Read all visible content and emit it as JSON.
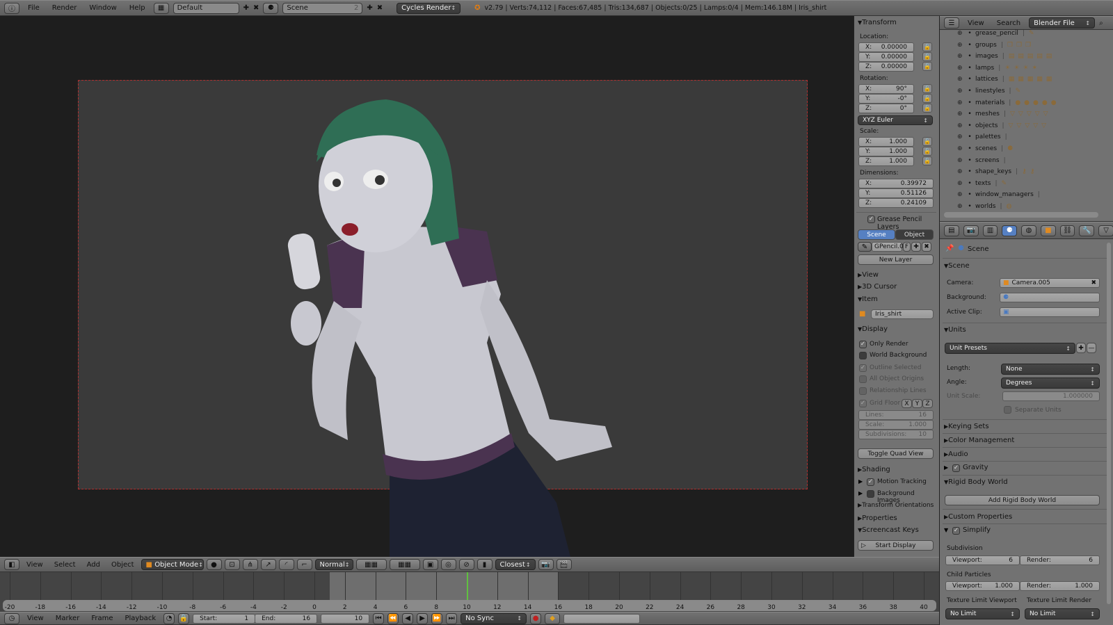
{
  "topbar": {
    "menus": [
      "File",
      "Render",
      "Window",
      "Help"
    ],
    "layout": "Default",
    "scene": "Scene",
    "scene_users": "2",
    "engine": "Cycles Render",
    "stats": "v2.79 | Verts:74,112 | Faces:67,485 | Tris:134,687 | Objects:0/25 | Lamps:0/4 | Mem:146.18M | Iris_shirt"
  },
  "npanel": {
    "transform": "Transform",
    "location": "Location:",
    "rotation": "Rotation:",
    "scale": "Scale:",
    "dimensions": "Dimensions:",
    "rotation_mode": "XYZ Euler",
    "loc": [
      {
        "a": "X:",
        "v": "0.00000"
      },
      {
        "a": "Y:",
        "v": "0.00000"
      },
      {
        "a": "Z:",
        "v": "0.00000"
      }
    ],
    "rot": [
      {
        "a": "X:",
        "v": "90°"
      },
      {
        "a": "Y:",
        "v": "-0°"
      },
      {
        "a": "Z:",
        "v": "0°"
      }
    ],
    "scl": [
      {
        "a": "X:",
        "v": "1.000"
      },
      {
        "a": "Y:",
        "v": "1.000"
      },
      {
        "a": "Z:",
        "v": "1.000"
      }
    ],
    "dim": [
      {
        "a": "X:",
        "v": "0.39972"
      },
      {
        "a": "Y:",
        "v": "0.51126"
      },
      {
        "a": "Z:",
        "v": "0.24109"
      }
    ],
    "gp": "Grease Pencil Layers",
    "gp_scene": "Scene",
    "gp_object": "Object",
    "gp_name": "GPencil.0",
    "gp_f": "F",
    "new_layer": "New Layer",
    "view": "View",
    "cursor": "3D Cursor",
    "item": "Item",
    "item_name": "Iris_shirt",
    "display": "Display",
    "only_render": "Only Render",
    "world_bg": "World Background",
    "outline_sel": "Outline Selected",
    "all_origins": "All Object Origins",
    "rel_lines": "Relationship Lines",
    "grid_floor": "Grid Floor",
    "gx": "X",
    "gy": "Y",
    "gz": "Z",
    "lines_l": "Lines:",
    "lines_v": "16",
    "gscale_l": "Scale:",
    "gscale_v": "1.000",
    "subdiv_l": "Subdivisions:",
    "subdiv_v": "10",
    "quad": "Toggle Quad View",
    "shading": "Shading",
    "motion": "Motion Tracking",
    "bgimages": "Background Images",
    "orient": "Transform Orientations",
    "props": "Properties",
    "screencast": "Screencast Keys",
    "start_display": "Start Display"
  },
  "outliner": {
    "view": "View",
    "search": "Search",
    "mode": "Blender File",
    "items": [
      {
        "l": "grease_pencil",
        "i": "✎"
      },
      {
        "l": "groups",
        "i": "❒❒❒"
      },
      {
        "l": "images",
        "i": "▤▤▤▤▤"
      },
      {
        "l": "lamps",
        "i": "☀☀☀✶"
      },
      {
        "l": "lattices",
        "i": "▦▦▦▦▦"
      },
      {
        "l": "linestyles",
        "i": "✎"
      },
      {
        "l": "materials",
        "i": "●●●●●"
      },
      {
        "l": "meshes",
        "i": "▽▽▽▽▽"
      },
      {
        "l": "objects",
        "i": "▽▽▽▽▽"
      },
      {
        "l": "palettes",
        "i": ""
      },
      {
        "l": "scenes",
        "i": "⚈"
      },
      {
        "l": "screens",
        "i": ""
      },
      {
        "l": "shape_keys",
        "i": "⚷⚷"
      },
      {
        "l": "texts",
        "i": "✎"
      },
      {
        "l": "window_managers",
        "i": ""
      },
      {
        "l": "worlds",
        "i": "◍"
      }
    ]
  },
  "props": {
    "breadcrumb": "Scene",
    "scene": "Scene",
    "camera_l": "Camera:",
    "camera_v": "Camera.005",
    "background_l": "Background:",
    "clip_l": "Active Clip:",
    "units": "Units",
    "unit_presets": "Unit Presets",
    "length_l": "Length:",
    "length_v": "None",
    "angle_l": "Angle:",
    "angle_v": "Degrees",
    "uscale_l": "Unit Scale:",
    "uscale_v": "1.000000",
    "separate": "Separate Units",
    "keying": "Keying Sets",
    "color": "Color Management",
    "audio": "Audio",
    "gravity": "Gravity",
    "rigid": "Rigid Body World",
    "add_rigid": "Add Rigid Body World",
    "custom": "Custom Properties",
    "simplify": "Simplify",
    "subdivision": "Subdivision",
    "vp_l": "Viewport:",
    "vp_v": "6",
    "rd_l": "Render:",
    "rd_v": "6",
    "child": "Child Particles",
    "cvp_v": "1.000",
    "crd_v": "1.000",
    "tex_vp": "Texture Limit Viewport",
    "tex_rd": "Texture Limit Render",
    "tex_vp_v": "No Limit",
    "tex_rd_v": "No Limit"
  },
  "view3d": {
    "menus": [
      "View",
      "Select",
      "Add",
      "Object"
    ],
    "mode": "Object Mode",
    "orientation": "Normal",
    "snap": "Closest"
  },
  "timeline": {
    "menus": [
      "View",
      "Marker",
      "Frame",
      "Playback"
    ],
    "start_l": "Start:",
    "start_v": "1",
    "end_l": "End:",
    "end_v": "16",
    "current": "10",
    "sync": "No Sync",
    "ticks": [
      "-20",
      "-18",
      "-16",
      "-14",
      "-12",
      "-10",
      "-8",
      "-6",
      "-4",
      "-2",
      "0",
      "2",
      "4",
      "6",
      "8",
      "10",
      "12",
      "14",
      "16",
      "18",
      "20",
      "22",
      "24",
      "26",
      "28",
      "30",
      "32",
      "34",
      "36",
      "38",
      "40"
    ],
    "frame_current": 10,
    "frame_start": 1,
    "frame_end": 16
  },
  "colors": {
    "accent": "#5680c2",
    "playhead": "#60c040",
    "hair": "#2f6e55",
    "sleeve": "#4a3350"
  }
}
